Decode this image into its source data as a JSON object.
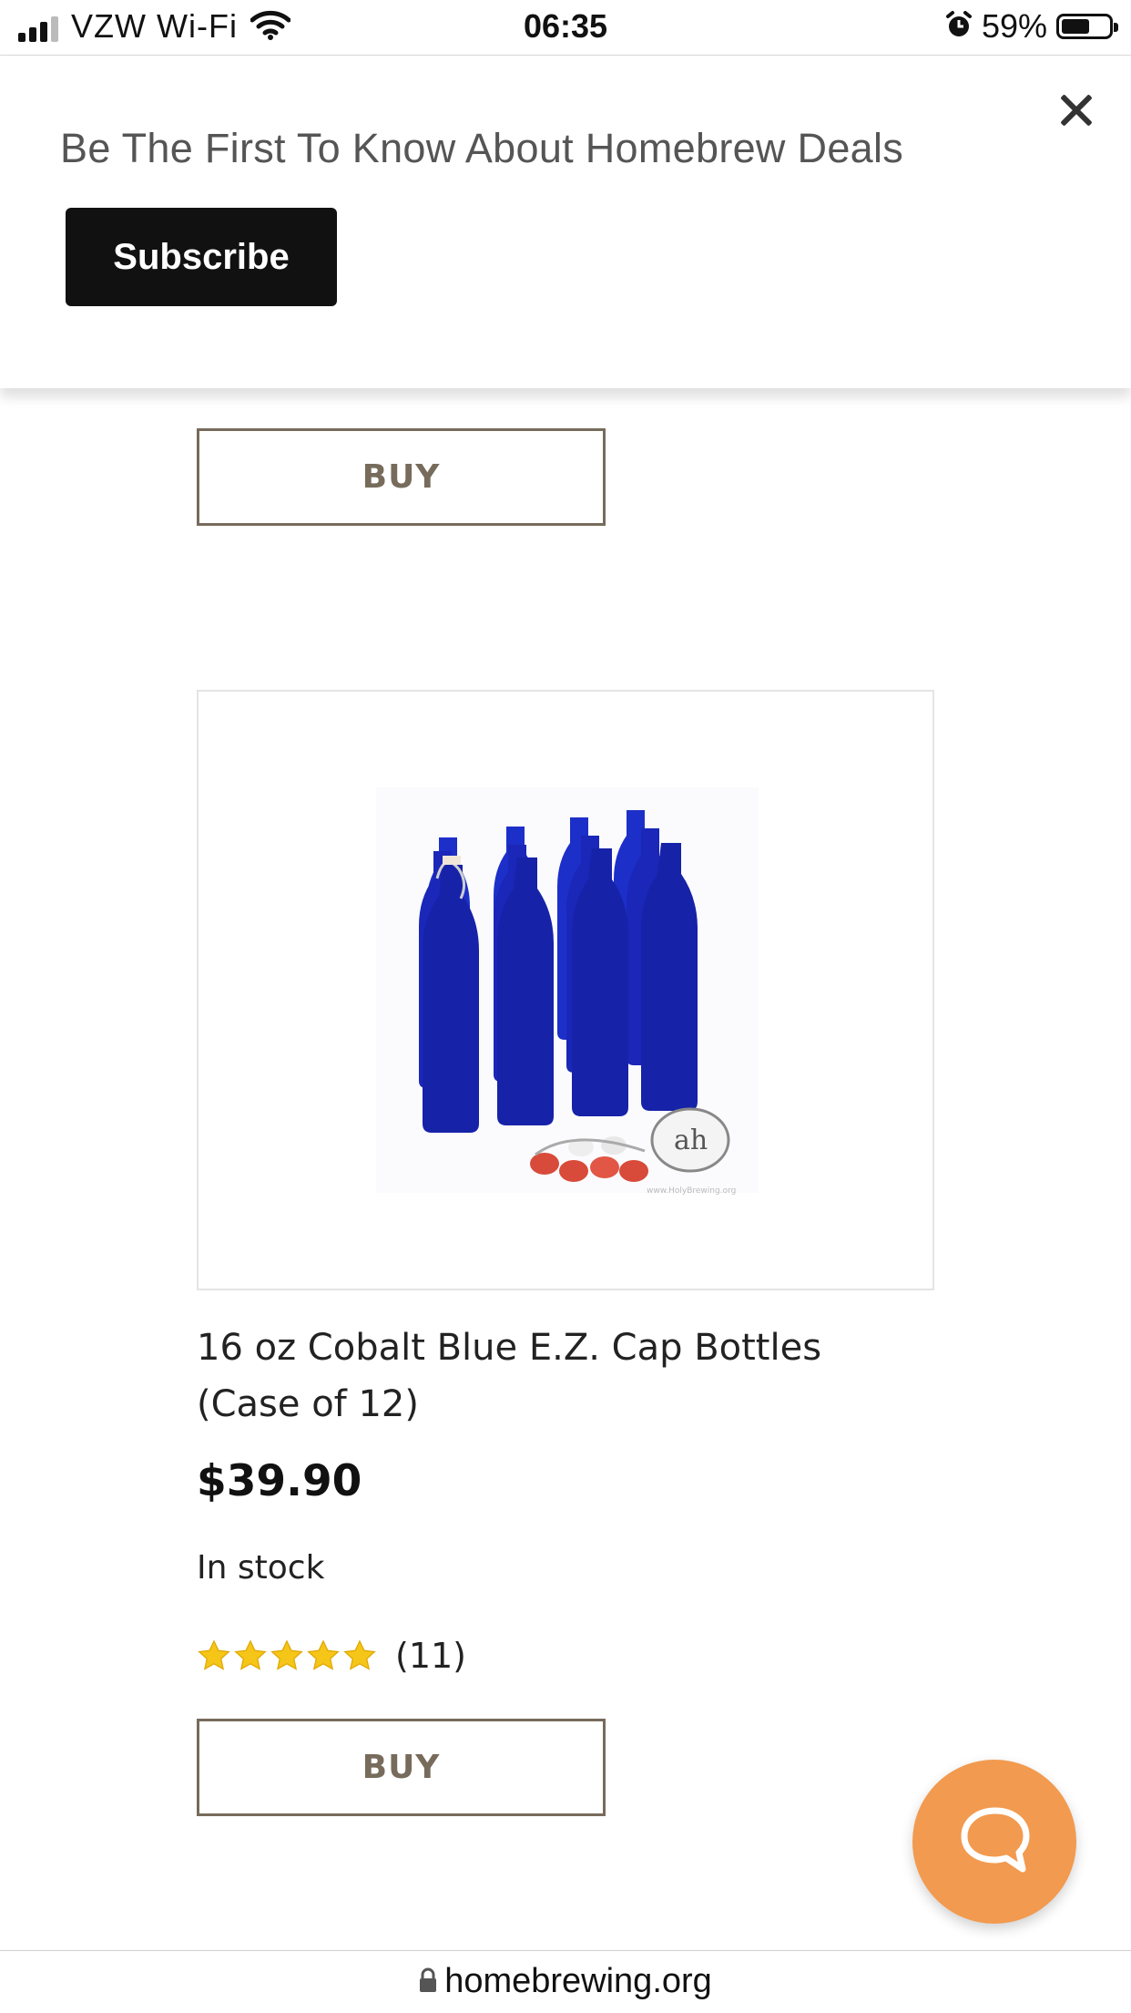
{
  "status_bar": {
    "carrier": "VZW Wi-Fi",
    "time": "06:35",
    "battery_percent": "59%",
    "battery_level": 0.59,
    "icons": [
      "signal-icon",
      "wifi-icon",
      "alarm-icon",
      "battery-icon"
    ]
  },
  "banner": {
    "text": "Be The First To Know About Homebrew Deals",
    "subscribe_label": "Subscribe",
    "close_icon": "close-icon"
  },
  "previous_product": {
    "buy_label": "BUY"
  },
  "product": {
    "title_line1": "16 oz Cobalt Blue E.Z. Cap Bottles",
    "title_line2": "(Case of 12)",
    "price": "$39.90",
    "stock": "In stock",
    "rating": 5,
    "rating_count": "(11)",
    "buy_label": "BUY",
    "image_watermark": "www.HolyBrewing.org"
  },
  "chat": {
    "icon": "chat-bubble-icon",
    "color": "#f29a4f"
  },
  "url_bar": {
    "domain": "homebrewing.org",
    "icon": "lock-icon"
  },
  "colors": {
    "buy_border": "#776b5c",
    "star": "#f5c518",
    "banner_button": "#111111"
  }
}
